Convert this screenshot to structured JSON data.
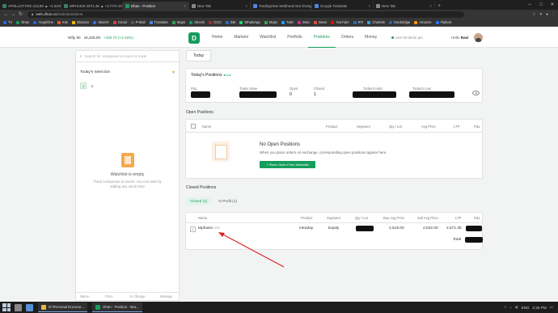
{
  "browser": {
    "tabs": [
      {
        "label": "APOLLOTYRE 213.80 ▲ +1.84% SAVE",
        "color": "#3a7f6a",
        "active": false
      },
      {
        "label": "MPHASIS 2571.35 ▲ +3.77% SAVE",
        "color": "#3a7f6a",
        "active": false
      },
      {
        "label": "Dhan - Position",
        "color": "#159d5c",
        "active": true
      },
      {
        "label": "New Tab",
        "color": "#888888",
        "active": false
      },
      {
        "label": "TradingView Webhook Not Giving Ti",
        "color": "#4a89dc",
        "active": false
      },
      {
        "label": "Google Translate",
        "color": "#4a89dc",
        "active": false
      },
      {
        "label": "New Tab",
        "color": "#888888",
        "active": false
      }
    ],
    "new_tab": "+",
    "window_controls": [
      "–",
      "□",
      "✕"
    ],
    "address": {
      "host": "web.dhan.co",
      "path": "/index/positions"
    },
    "bookmarks": [
      {
        "label": "TV",
        "color": "#2962ff"
      },
      {
        "label": "Dhan",
        "color": "#159d5c"
      },
      {
        "label": "AngelOne",
        "color": "#1e6bd6"
      },
      {
        "label": "Kite",
        "color": "#e25c2f"
      },
      {
        "label": "Binance",
        "color": "#f0b90b"
      },
      {
        "label": "WazirX",
        "color": "#2e6cf6"
      },
      {
        "label": "Gmail",
        "color": "#d44638"
      },
      {
        "label": "P-Mail",
        "color": "#555555"
      },
      {
        "label": "Translate",
        "color": "#4a89dc"
      },
      {
        "label": "Maps",
        "color": "#34a853"
      },
      {
        "label": "Sheets",
        "color": "#0f9d58"
      },
      {
        "label": "ICICI",
        "color": "#b02a30"
      },
      {
        "label": "SBI",
        "color": "#2a6ebb"
      },
      {
        "label": "WhatsApp",
        "color": "#25d366"
      },
      {
        "label": "Maps",
        "color": "#34a853"
      },
      {
        "label": "Twitt",
        "color": "#1da1f2"
      },
      {
        "label": "Insta",
        "color": "#c13584"
      },
      {
        "label": "News",
        "color": "#e74c3c"
      },
      {
        "label": "YouTube",
        "color": "#ff0000"
      },
      {
        "label": "RTI",
        "color": "#2a6ebb"
      },
      {
        "label": "Chartink",
        "color": "#3aa0d8"
      },
      {
        "label": "StockEdge",
        "color": "#2266aa"
      },
      {
        "label": "Amazon",
        "color": "#ff9900"
      },
      {
        "label": "Flipkart",
        "color": "#2874f0"
      }
    ]
  },
  "header": {
    "index_name": "Nifty 50",
    "index_value": "16,225.00",
    "index_change": "+182.70 (+2.42%)",
    "logo": "D",
    "nav": [
      "Home",
      "Markets",
      "Watchlist",
      "Portfolio",
      "Positions",
      "Orders",
      "Money"
    ],
    "active_nav": "Positions",
    "live": "Live 02:25:02 pm",
    "greeting": "Hello",
    "user": "Ravi"
  },
  "sidebar": {
    "search_placeholder": "Search for companies to invest or trade",
    "selection_title": "Today's Selection",
    "pages": [
      "1",
      "2"
    ],
    "empty_title": "Watchlist is empty",
    "empty_sub": "Track companies to invest. You can start by adding any stock here",
    "footer": [
      "Name",
      "Price",
      "% Change",
      "Manage"
    ]
  },
  "today_button": "Today",
  "todays_positions": {
    "title": "Today's Positions",
    "live_tag": "Live",
    "labels": {
      "pnl": "P&L",
      "trade_value": "Trade Value",
      "open": "Open",
      "closed": "Closed",
      "todays_high": "Today's High",
      "todays_low": "Today's Low"
    },
    "values": {
      "open": "0",
      "closed": "1"
    }
  },
  "open_positions": {
    "title": "Open Positions",
    "columns": [
      "Name",
      "Product",
      "Segment",
      "Qty / Lot",
      "Avg Price",
      "LTP",
      "P&L"
    ],
    "empty_title": "No Open Positions",
    "empty_sub": "When you place orders on exchange, corresponding open positions appear here.",
    "cta": "+ Place Order From Watchlist"
  },
  "closed_positions": {
    "title": "Closed Positions",
    "tabs": [
      "Closed (1)",
      "In Profit (1)"
    ],
    "columns": [
      "Name",
      "Product",
      "Segment",
      "Qty / Lot",
      "Buy Avg Price",
      "Sell Avg Price",
      "LTP",
      "P&L"
    ],
    "rows": [
      {
        "name": "Mphasis",
        "exchange": "NSE",
        "product": "Intraday",
        "segment": "Equity",
        "buy_avg": "2,519.00",
        "sell_avg": "2,532.00",
        "ltp": "2,571.35"
      }
    ],
    "total_label": "Total"
  },
  "annotation": {
    "arrow_color": "#e02020"
  },
  "taskbar": {
    "apps": [
      {
        "label": "D:\\Personal Docume...",
        "color": "#e8b64a"
      },
      {
        "label": "Dhan - Position - Bra...",
        "color": "#159d5c"
      }
    ],
    "time": "2:25 PM",
    "lang": "ENG"
  }
}
